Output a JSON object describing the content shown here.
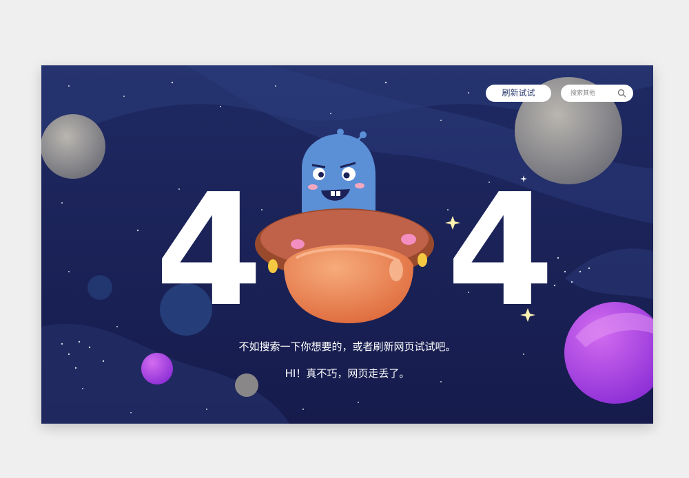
{
  "header": {
    "refresh_label": "刷新试试",
    "search": {
      "placeholder": "搜索其他",
      "icon": "search-icon"
    }
  },
  "hero": {
    "code_left": "4",
    "code_right": "4",
    "illustration": "alien-in-ufo"
  },
  "messages": {
    "line1": "不如搜索一下你想要的，或者刷新网页试试吧。",
    "line2": "HI！真不巧，网页走丢了。"
  },
  "colors": {
    "background": "#1c2258",
    "accent_purple": "#a53be0",
    "ufo_orange": "#e97c4b",
    "alien_blue": "#5b8fd6"
  }
}
